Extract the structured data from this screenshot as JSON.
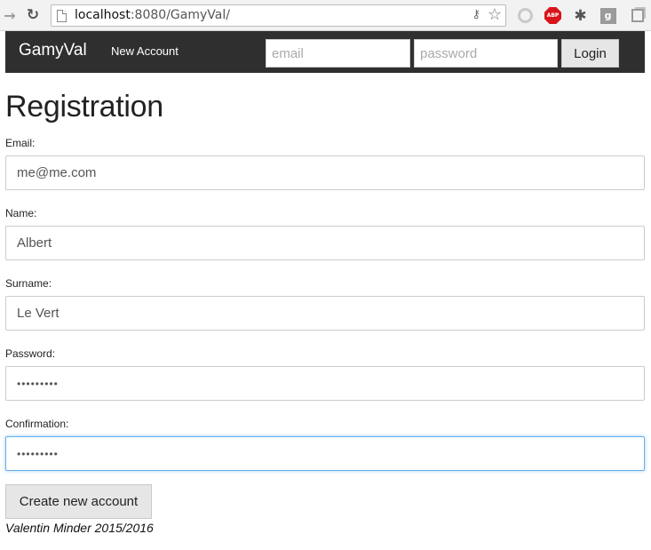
{
  "browser": {
    "url_host": "localhost",
    "url_path": ":8080/GamyVal/",
    "icons": {
      "back": "arrow-left",
      "reload": "reload",
      "page": "page",
      "key": "key",
      "bookmark": "star",
      "ext1": "circle",
      "adblock_label": "ABP",
      "extensions": "puzzle",
      "gplus_label": "g",
      "menu": "windows"
    }
  },
  "navbar": {
    "brand": "GamyVal",
    "new_account_link": "New Account",
    "email_placeholder": "email",
    "password_placeholder": "password",
    "login_label": "Login",
    "background": "#2f2f2f"
  },
  "registration": {
    "title": "Registration",
    "fields": [
      {
        "label": "Email:",
        "value": "me@me.com"
      },
      {
        "label": "Name:",
        "value": "Albert"
      },
      {
        "label": "Surname:",
        "value": "Le Vert"
      },
      {
        "label": "Password:",
        "value": "•••••••••"
      },
      {
        "label": "Confirmation:",
        "value": "•••••••••"
      }
    ],
    "submit_label": "Create new account",
    "focus_color": "#66afe9"
  },
  "footer": {
    "text": "Valentin Minder 2015/2016"
  }
}
